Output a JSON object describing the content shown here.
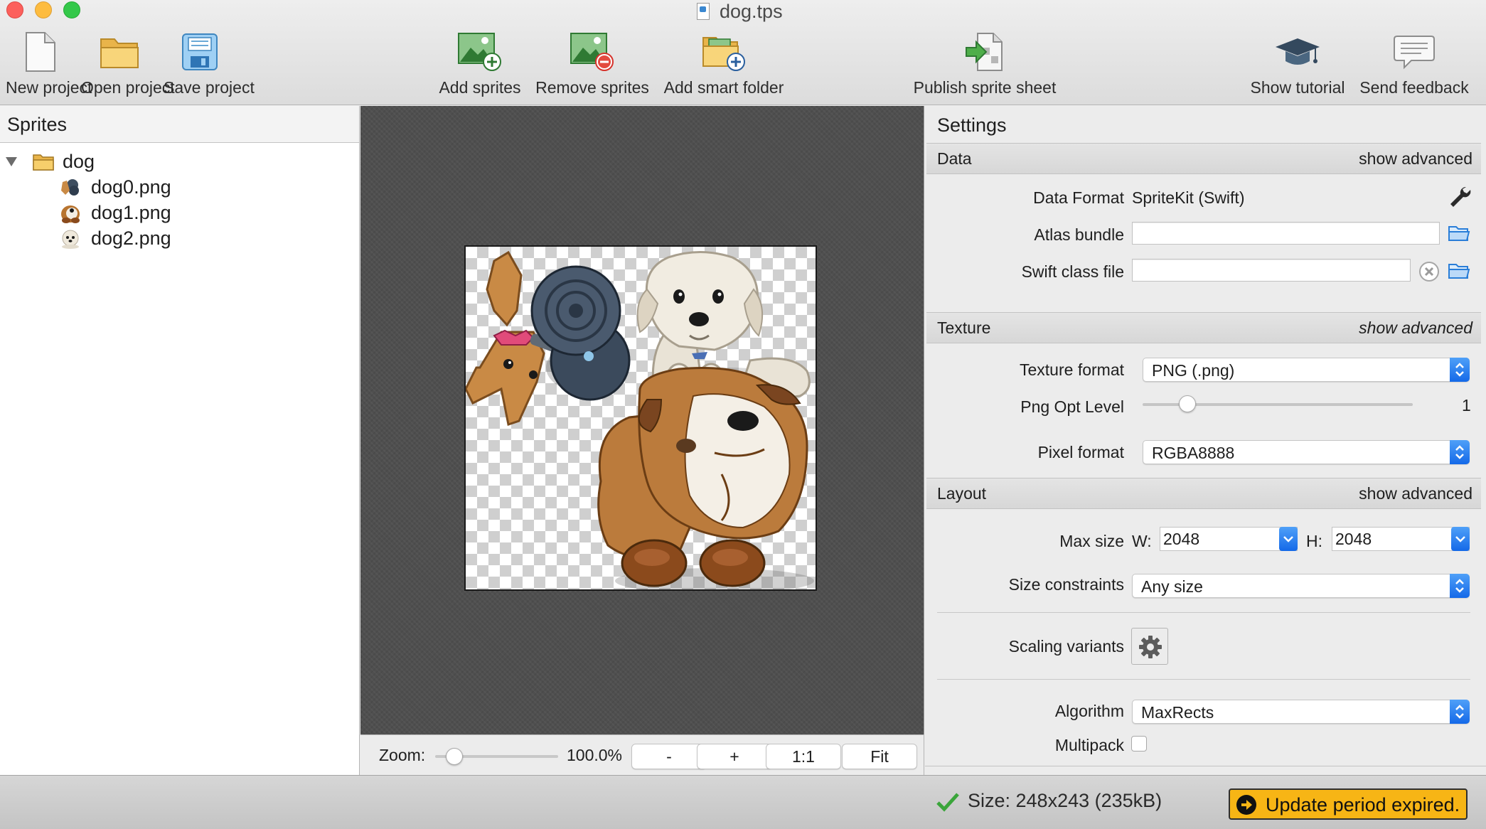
{
  "window": {
    "title": "dog.tps"
  },
  "toolbar": {
    "new_project": "New project",
    "open_project": "Open project",
    "save_project": "Save project",
    "add_sprites": "Add sprites",
    "remove_sprites": "Remove sprites",
    "add_smart_folder": "Add smart folder",
    "publish_sprite_sheet": "Publish sprite sheet",
    "show_tutorial": "Show tutorial",
    "send_feedback": "Send feedback"
  },
  "sprites_panel": {
    "title": "Sprites",
    "folder": {
      "name": "dog",
      "icon": "folder-icon",
      "expanded": true
    },
    "items": [
      {
        "name": "dog0.png",
        "icon": "chihuahua-thumbnail-icon"
      },
      {
        "name": "dog1.png",
        "icon": "bulldog-thumbnail-icon"
      },
      {
        "name": "dog2.png",
        "icon": "puppy-thumbnail-icon"
      }
    ]
  },
  "preview": {
    "zoom_label": "Zoom:",
    "zoom_value": "100.0%",
    "zoom_fraction": 0.1,
    "zoom_out": "-",
    "zoom_in": "+",
    "actual_size": "1:1",
    "fit": "Fit"
  },
  "settings": {
    "title": "Settings",
    "data": {
      "header": "Data",
      "advanced": "show advanced",
      "data_format_label": "Data Format",
      "data_format_value": "SpriteKit (Swift)",
      "atlas_bundle_label": "Atlas bundle",
      "atlas_bundle_value": "",
      "swift_class_file_label": "Swift class file",
      "swift_class_file_value": ""
    },
    "texture": {
      "header": "Texture",
      "advanced": "show advanced",
      "texture_format_label": "Texture format",
      "texture_format_value": "PNG (.png)",
      "png_opt_level_label": "Png Opt Level",
      "png_opt_level_value": "1",
      "png_opt_level_fraction": 0.17,
      "pixel_format_label": "Pixel format",
      "pixel_format_value": "RGBA8888"
    },
    "layout": {
      "header": "Layout",
      "advanced": "show advanced",
      "max_size_label": "Max size",
      "width_label": "W:",
      "width_value": "2048",
      "height_label": "H:",
      "height_value": "2048",
      "size_constraints_label": "Size constraints",
      "size_constraints_value": "Any size",
      "scaling_variants_label": "Scaling variants",
      "algorithm_label": "Algorithm",
      "algorithm_value": "MaxRects",
      "multipack_label": "Multipack",
      "multipack_checked": false
    }
  },
  "status": {
    "size_text": "Size: 248x243 (235kB)",
    "update_text": "Update period expired."
  },
  "colors": {
    "accent_blue": "#1469e8",
    "update_yellow": "#f7b515",
    "success_green": "#3aa53a"
  }
}
